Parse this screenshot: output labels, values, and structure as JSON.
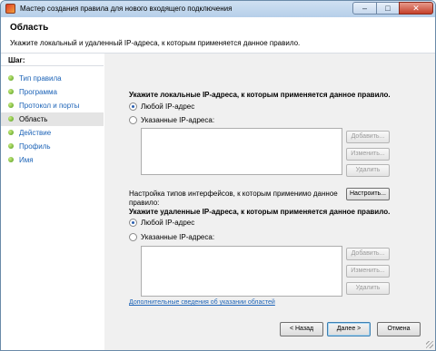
{
  "window": {
    "title": "Мастер создания правила для нового входящего подключения",
    "minimize_glyph": "–",
    "maximize_glyph": "□",
    "close_glyph": "✕"
  },
  "header": {
    "title": "Область",
    "subtitle": "Укажите локальный и удаленный IP-адреса, к которым применяется данное правило."
  },
  "steps": {
    "heading": "Шаг:",
    "items": [
      {
        "label": "Тип правила"
      },
      {
        "label": "Программа"
      },
      {
        "label": "Протокол и порты"
      },
      {
        "label": "Область"
      },
      {
        "label": "Действие"
      },
      {
        "label": "Профиль"
      },
      {
        "label": "Имя"
      }
    ],
    "active_index": 3
  },
  "local": {
    "heading": "Укажите локальные IP-адреса, к которым применяется данное правило.",
    "option_any": "Любой IP-адрес",
    "option_specified": "Указанные IP-адреса:",
    "selected": "any",
    "buttons": {
      "add": "Добавить...",
      "edit": "Изменить...",
      "remove": "Удалить"
    }
  },
  "interfaces": {
    "text_line1": "Настройка типов интерфейсов, к которым применимо данное",
    "text_line2": "правило:",
    "configure_button": "Настроить..."
  },
  "remote": {
    "heading": "Укажите удаленные IP-адреса, к которым применяется данное правило.",
    "option_any": "Любой IP-адрес",
    "option_specified": "Указанные IP-адреса:",
    "selected": "any",
    "buttons": {
      "add": "Добавить...",
      "edit": "Изменить...",
      "remove": "Удалить"
    }
  },
  "more_info_link": "Дополнительные сведения об указании областей",
  "footer": {
    "back": "< Назад",
    "next": "Далее >",
    "cancel": "Отмена"
  }
}
